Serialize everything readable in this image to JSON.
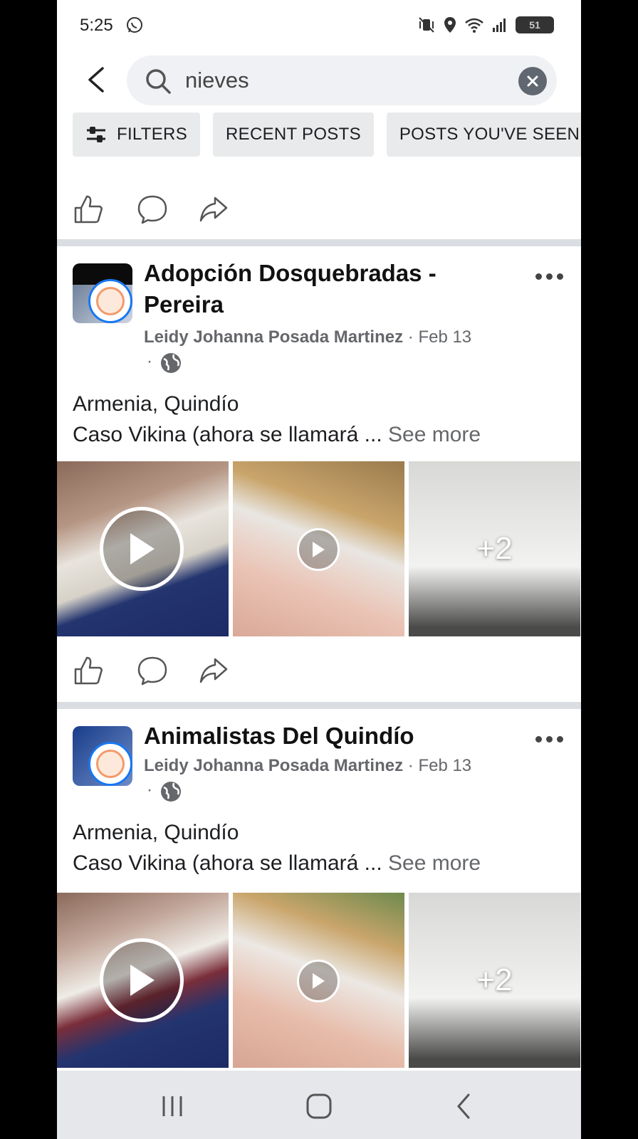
{
  "status_bar": {
    "time": "5:25",
    "battery": "51"
  },
  "search": {
    "query": "nieves",
    "placeholder": "Search"
  },
  "filters": [
    {
      "label": "FILTERS",
      "icon": "sliders-icon"
    },
    {
      "label": "RECENT POSTS"
    },
    {
      "label": "POSTS YOU'VE SEEN"
    }
  ],
  "posts": [
    {
      "group": "Adopción Dosquebradas - Pereira",
      "author": "Leidy Johanna Posada Martinez",
      "date": "Feb 13",
      "location": "Armenia, Quindío",
      "text": "Caso Vikina (ahora se llamará ...",
      "see_more": "See more",
      "extra_media": "+2"
    },
    {
      "group": "Animalistas Del Quindío",
      "author": "Leidy Johanna Posada Martinez",
      "date": "Feb 13",
      "location": "Armenia, Quindío",
      "text": "Caso Vikina (ahora se llamará ...",
      "see_more": "See more",
      "extra_media": "+2"
    }
  ],
  "colors": {
    "accent": "#1877f2",
    "secondary_text": "#65676b",
    "chip_bg": "#e9eaec"
  }
}
